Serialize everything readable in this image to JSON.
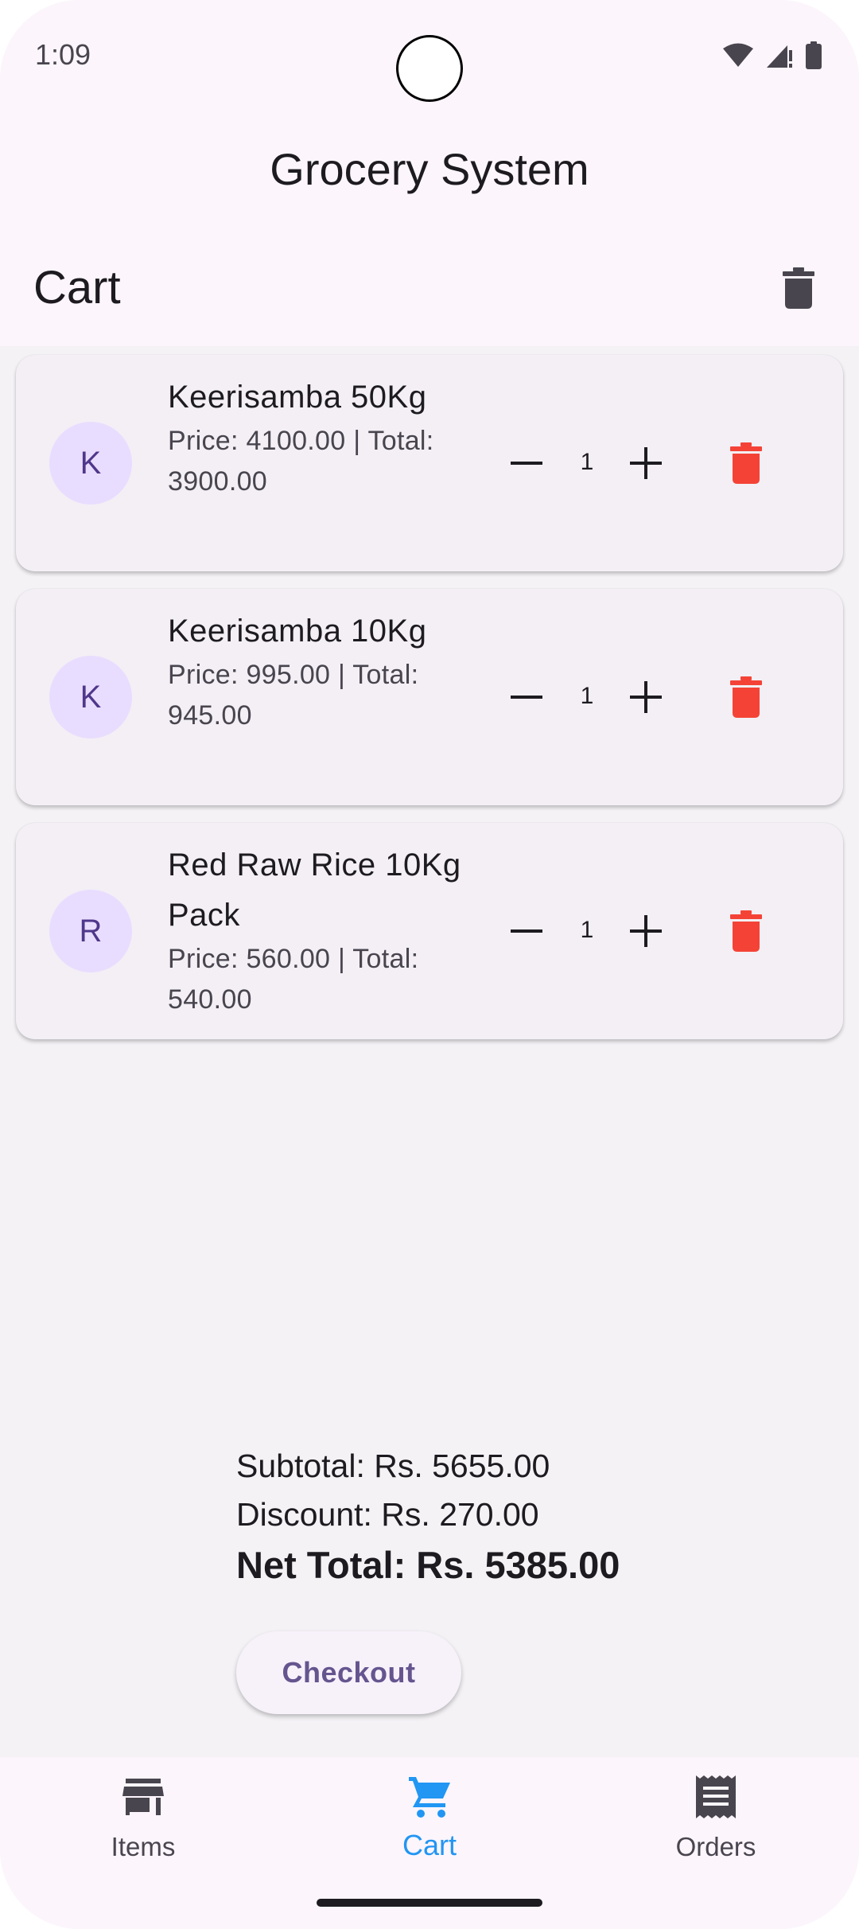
{
  "status_bar": {
    "time": "1:09"
  },
  "app": {
    "title": "Grocery System"
  },
  "page": {
    "title": "Cart"
  },
  "cart": {
    "items": [
      {
        "initial": "K",
        "name": "Keerisamba 50Kg",
        "price_line": "Price: 4100.00 | Total: 3900.00",
        "quantity": "1"
      },
      {
        "initial": "K",
        "name": "Keerisamba 10Kg",
        "price_line": "Price: 995.00 | Total: 945.00",
        "quantity": "1"
      },
      {
        "initial": "R",
        "name": "Red Raw Rice 10Kg Pack",
        "price_line": "Price: 560.00 | Total: 540.00",
        "quantity": "1"
      }
    ]
  },
  "summary": {
    "subtotal": "Subtotal: Rs. 5655.00",
    "discount": "Discount: Rs. 270.00",
    "net_total": "Net Total: Rs. 5385.00"
  },
  "checkout": {
    "label": "Checkout"
  },
  "bottom_nav": {
    "items": [
      {
        "label": "Items",
        "icon": "store-icon",
        "active": false
      },
      {
        "label": "Cart",
        "icon": "cart-icon",
        "active": true
      },
      {
        "label": "Orders",
        "icon": "receipt-icon",
        "active": false
      }
    ]
  },
  "colors": {
    "accent": "#2196f3",
    "delete": "#f44336",
    "primary_text": "#65558f",
    "avatar_bg": "#e9ddff"
  }
}
